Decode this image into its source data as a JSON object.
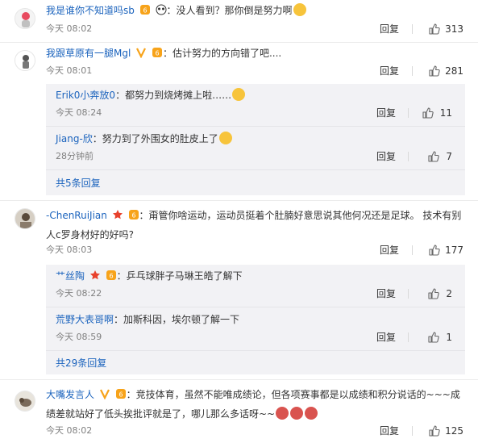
{
  "comments": [
    {
      "user": "我是谁你不知道吗sb",
      "text": "：没人看到？那你倒是努力啊",
      "time": "今天 08:02",
      "reply": "回复",
      "likes": "313"
    },
    {
      "user": "我跟草原有一腿Mgl",
      "text": "：估计努力的方向错了吧....",
      "time": "今天 08:01",
      "reply": "回复",
      "likes": "281",
      "subs": [
        {
          "user": "Erik0小奔放0",
          "text": "：都努力到烧烤摊上啦……",
          "time": "今天 08:24",
          "reply": "回复",
          "likes": "11"
        },
        {
          "user": "Jiang-欣",
          "text": "：努力到了外围女的肚皮上了",
          "time": "28分钟前",
          "reply": "回复",
          "likes": "7"
        }
      ],
      "more": "共5条回复"
    },
    {
      "user": "-ChenRuiJian",
      "text": "：甭管你啥运动，运动员挺着个肚腩好意思说其他何况还是足球。 技术有别人c罗身材好的好吗?",
      "time": "今天 08:03",
      "reply": "回复",
      "likes": "177",
      "subs": [
        {
          "user": "艹丝陶",
          "text": "：乒乓球胖子马琳王皓了解下",
          "time": "今天 08:22",
          "reply": "回复",
          "likes": "2"
        },
        {
          "user": "荒野大表哥啊",
          "text": "：加斯科因，埃尔顿了解一下",
          "time": "今天 08:59",
          "reply": "回复",
          "likes": "1"
        }
      ],
      "more": "共29条回复"
    },
    {
      "user": "大嘴发言人",
      "text": "：竞技体育，虽然不能唯成绩论，但各项赛事都是以成绩和积分说话的~~~成绩差就站好了低头挨批评就是了，哪儿那么多话呀~~",
      "time": "今天 08:02",
      "reply": "回复",
      "likes": "125"
    }
  ],
  "colors": {
    "username_orange": "#eb7350",
    "username_blue": "#1b63bd",
    "sub_bg": "#f2f2f5"
  }
}
